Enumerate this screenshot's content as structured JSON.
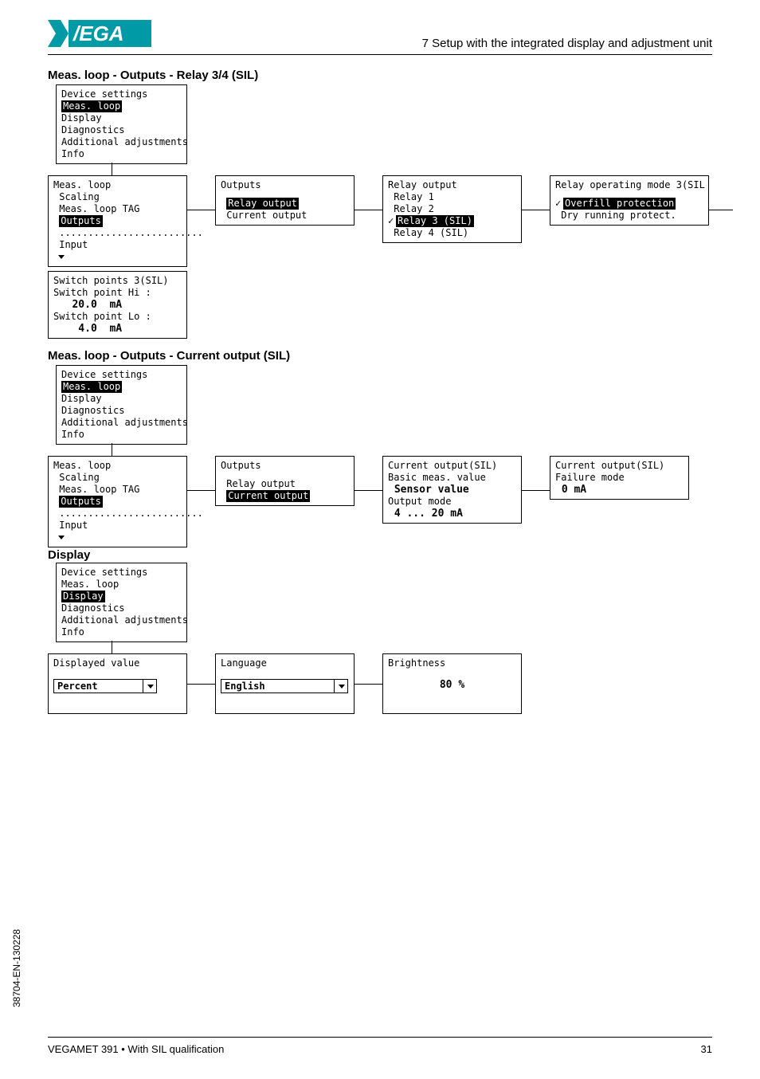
{
  "header": {
    "section_text": "7 Setup with the integrated display and adjustment unit"
  },
  "titles": {
    "relay34": "Meas. loop - Outputs - Relay 3/4 (SIL)",
    "current": "Meas. loop - Outputs - Current output (SIL)",
    "display": "Display"
  },
  "menu_main": {
    "device_settings": "Device settings",
    "meas_loop": "Meas. loop",
    "display": "Display",
    "diagnostics": "Diagnostics",
    "additional": "Additional adjustments",
    "info": "Info"
  },
  "menu_measloop": {
    "meas_loop": "Meas. loop",
    "scaling": " Scaling",
    "tag": " Meas. loop TAG",
    "outputs": "Outputs",
    "dots": " .........................",
    "input": " Input"
  },
  "menu_outputs_relay": {
    "title": "Outputs",
    "relay_output": "Relay output",
    "current_output": " Current output"
  },
  "menu_relay_output": {
    "title": "Relay output",
    "r1": " Relay 1",
    "r2": " Relay 2",
    "r3": "Relay 3 (SIL)",
    "r4": " Relay 4 (SIL)"
  },
  "menu_relay_mode": {
    "title": "Relay operating mode 3(SIL",
    "overfill": "Overfill protection",
    "dry": " Dry running protect."
  },
  "menu_switch_points": {
    "title": "Switch points 3(SIL)",
    "hi_label": "Switch point Hi :",
    "hi_value": "   20.0  mA",
    "lo_label": "Switch point Lo :",
    "lo_value": "    4.0  mA"
  },
  "menu_outputs_current": {
    "title": "Outputs",
    "relay_output": " Relay output",
    "current_output": "Current output"
  },
  "menu_current_output": {
    "title": "Current output(SIL)",
    "basic": "Basic meas. value",
    "sensor": " Sensor value",
    "mode": "Output mode",
    "range": " 4 ... 20 mA"
  },
  "menu_current_failure": {
    "title": "Current output(SIL)",
    "failure": "Failure mode",
    "value": " 0 mA"
  },
  "menu_display_main": {
    "device_settings": "Device settings",
    "meas_loop": "Meas. loop",
    "display": "Display",
    "diagnostics": "Diagnostics",
    "additional": "Additional adjustments",
    "info": "Info"
  },
  "menu_displayed_value": {
    "title": "Displayed value",
    "value": "Percent"
  },
  "menu_language": {
    "title": "Language",
    "value": "English"
  },
  "menu_brightness": {
    "title": "Brightness",
    "value": "80 %"
  },
  "side_text": "38704-EN-130228",
  "footer": {
    "left": "VEGAMET 391 • With SIL qualification",
    "right": "31"
  }
}
